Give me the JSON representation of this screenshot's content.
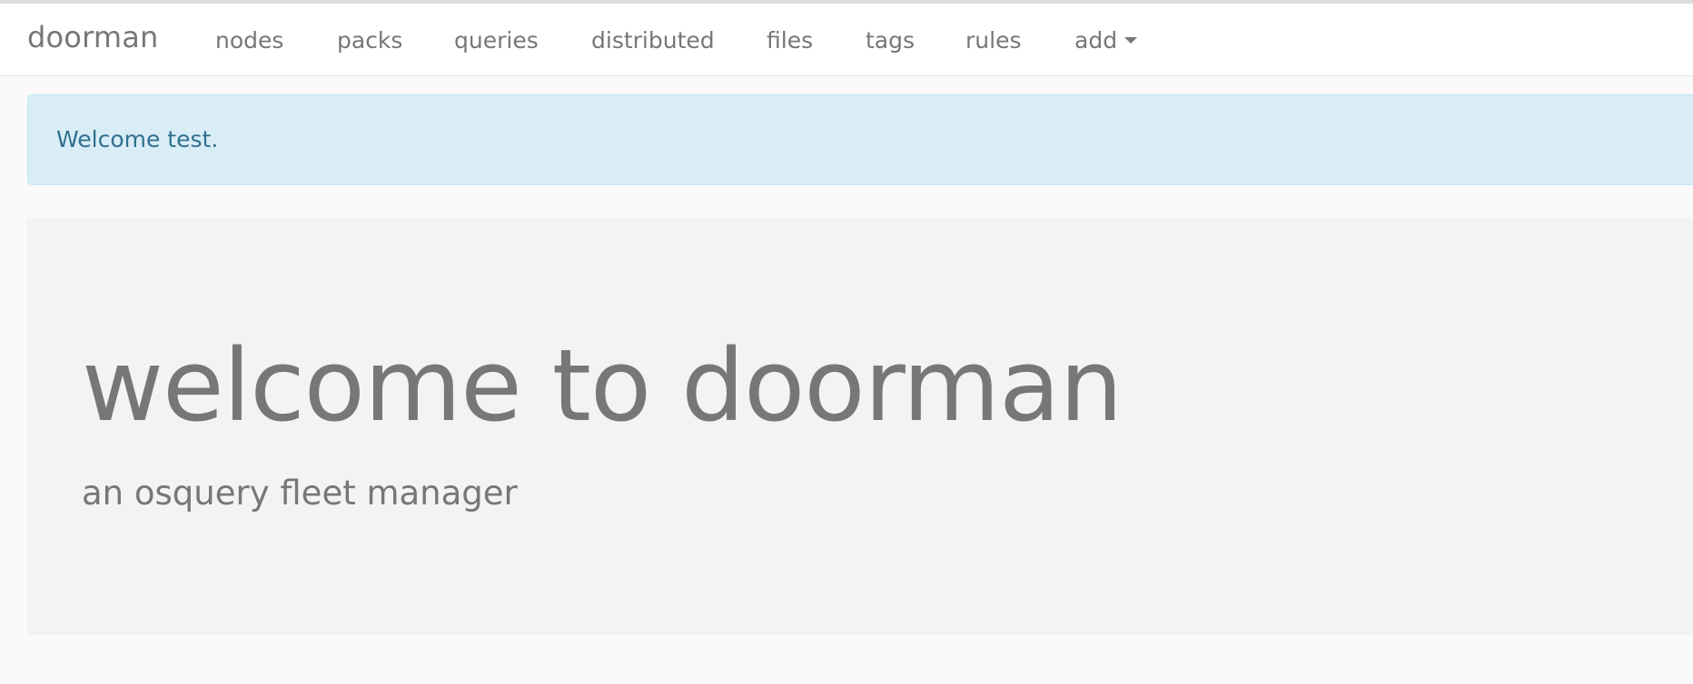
{
  "navbar": {
    "brand": "doorman",
    "links": [
      {
        "label": "nodes"
      },
      {
        "label": "packs"
      },
      {
        "label": "queries"
      },
      {
        "label": "distributed"
      },
      {
        "label": "files"
      },
      {
        "label": "tags"
      },
      {
        "label": "rules"
      },
      {
        "label": "add"
      }
    ],
    "add_dropdown_icon": "caret-down-icon"
  },
  "alert": {
    "message": "Welcome test.",
    "colors": {
      "background": "#d9edf7",
      "border": "#bce8f1",
      "text": "#31708f"
    }
  },
  "jumbotron": {
    "title": "welcome to doorman",
    "subtitle": "an osquery fleet manager"
  }
}
